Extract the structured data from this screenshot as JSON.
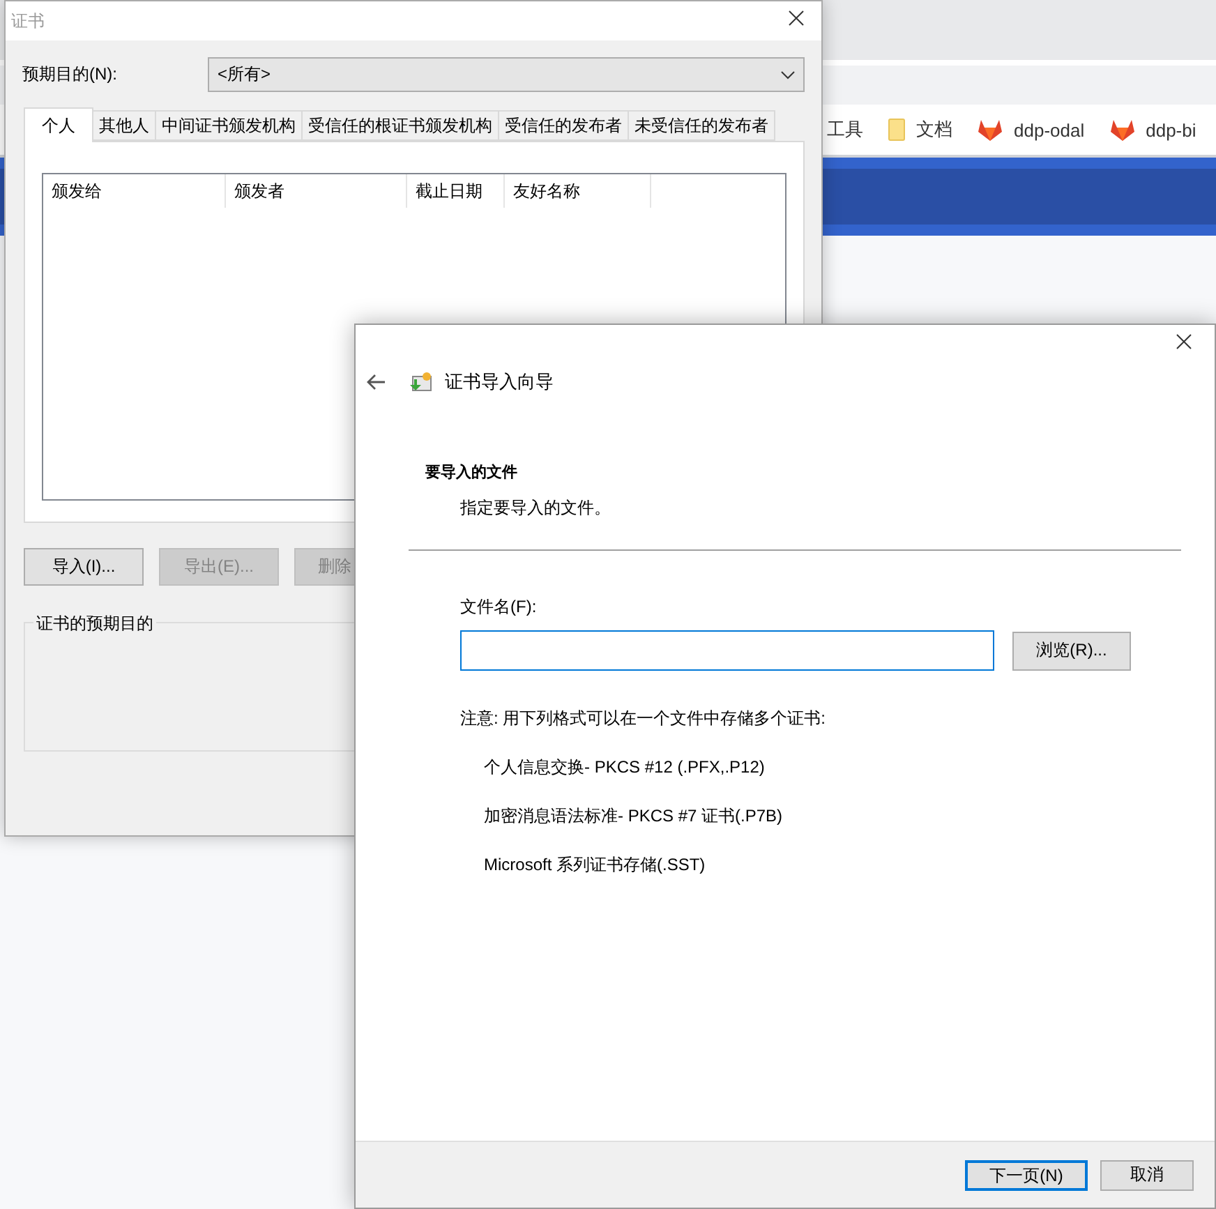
{
  "browser": {
    "bookmarks": [
      {
        "kind": "text",
        "label": "工具"
      },
      {
        "kind": "folder",
        "label": "文档"
      },
      {
        "kind": "gitlab",
        "label": "ddp-odal"
      },
      {
        "kind": "gitlab",
        "label": "ddp-bi"
      }
    ]
  },
  "certificates_window": {
    "title": "证书",
    "purpose_label": "预期目的(N):",
    "purpose_value": "<所有>",
    "tabs": [
      {
        "label": "个人",
        "selected": true
      },
      {
        "label": "其他人",
        "selected": false
      },
      {
        "label": "中间证书颁发机构",
        "selected": false
      },
      {
        "label": "受信任的根证书颁发机构",
        "selected": false
      },
      {
        "label": "受信任的发布者",
        "selected": false
      },
      {
        "label": "未受信任的发布者",
        "selected": false
      }
    ],
    "table": {
      "columns": [
        "颁发给",
        "颁发者",
        "截止日期",
        "友好名称"
      ]
    },
    "buttons": [
      {
        "label": "导入(I)...",
        "disabled": false
      },
      {
        "label": "导出(E)...",
        "disabled": true
      },
      {
        "label": "删除",
        "disabled": true
      }
    ],
    "group_title": "证书的预期目的"
  },
  "import_wizard": {
    "title": "证书导入向导",
    "heading": "要导入的文件",
    "subheading": "指定要导入的文件。",
    "file_label": "文件名(F):",
    "file_focused": true,
    "browse_button": "浏览(R)...",
    "note": "注意: 用下列格式可以在一个文件中存储多个证书:",
    "formats": [
      "个人信息交换- PKCS #12 (.PFX,.P12)",
      "加密消息语法标准- PKCS #7 证书(.P7B)",
      "Microsoft 系列证书存储(.SST)"
    ],
    "footer_buttons": [
      {
        "label": "下一页(N)",
        "default": true
      },
      {
        "label": "取消",
        "default": false
      }
    ]
  }
}
